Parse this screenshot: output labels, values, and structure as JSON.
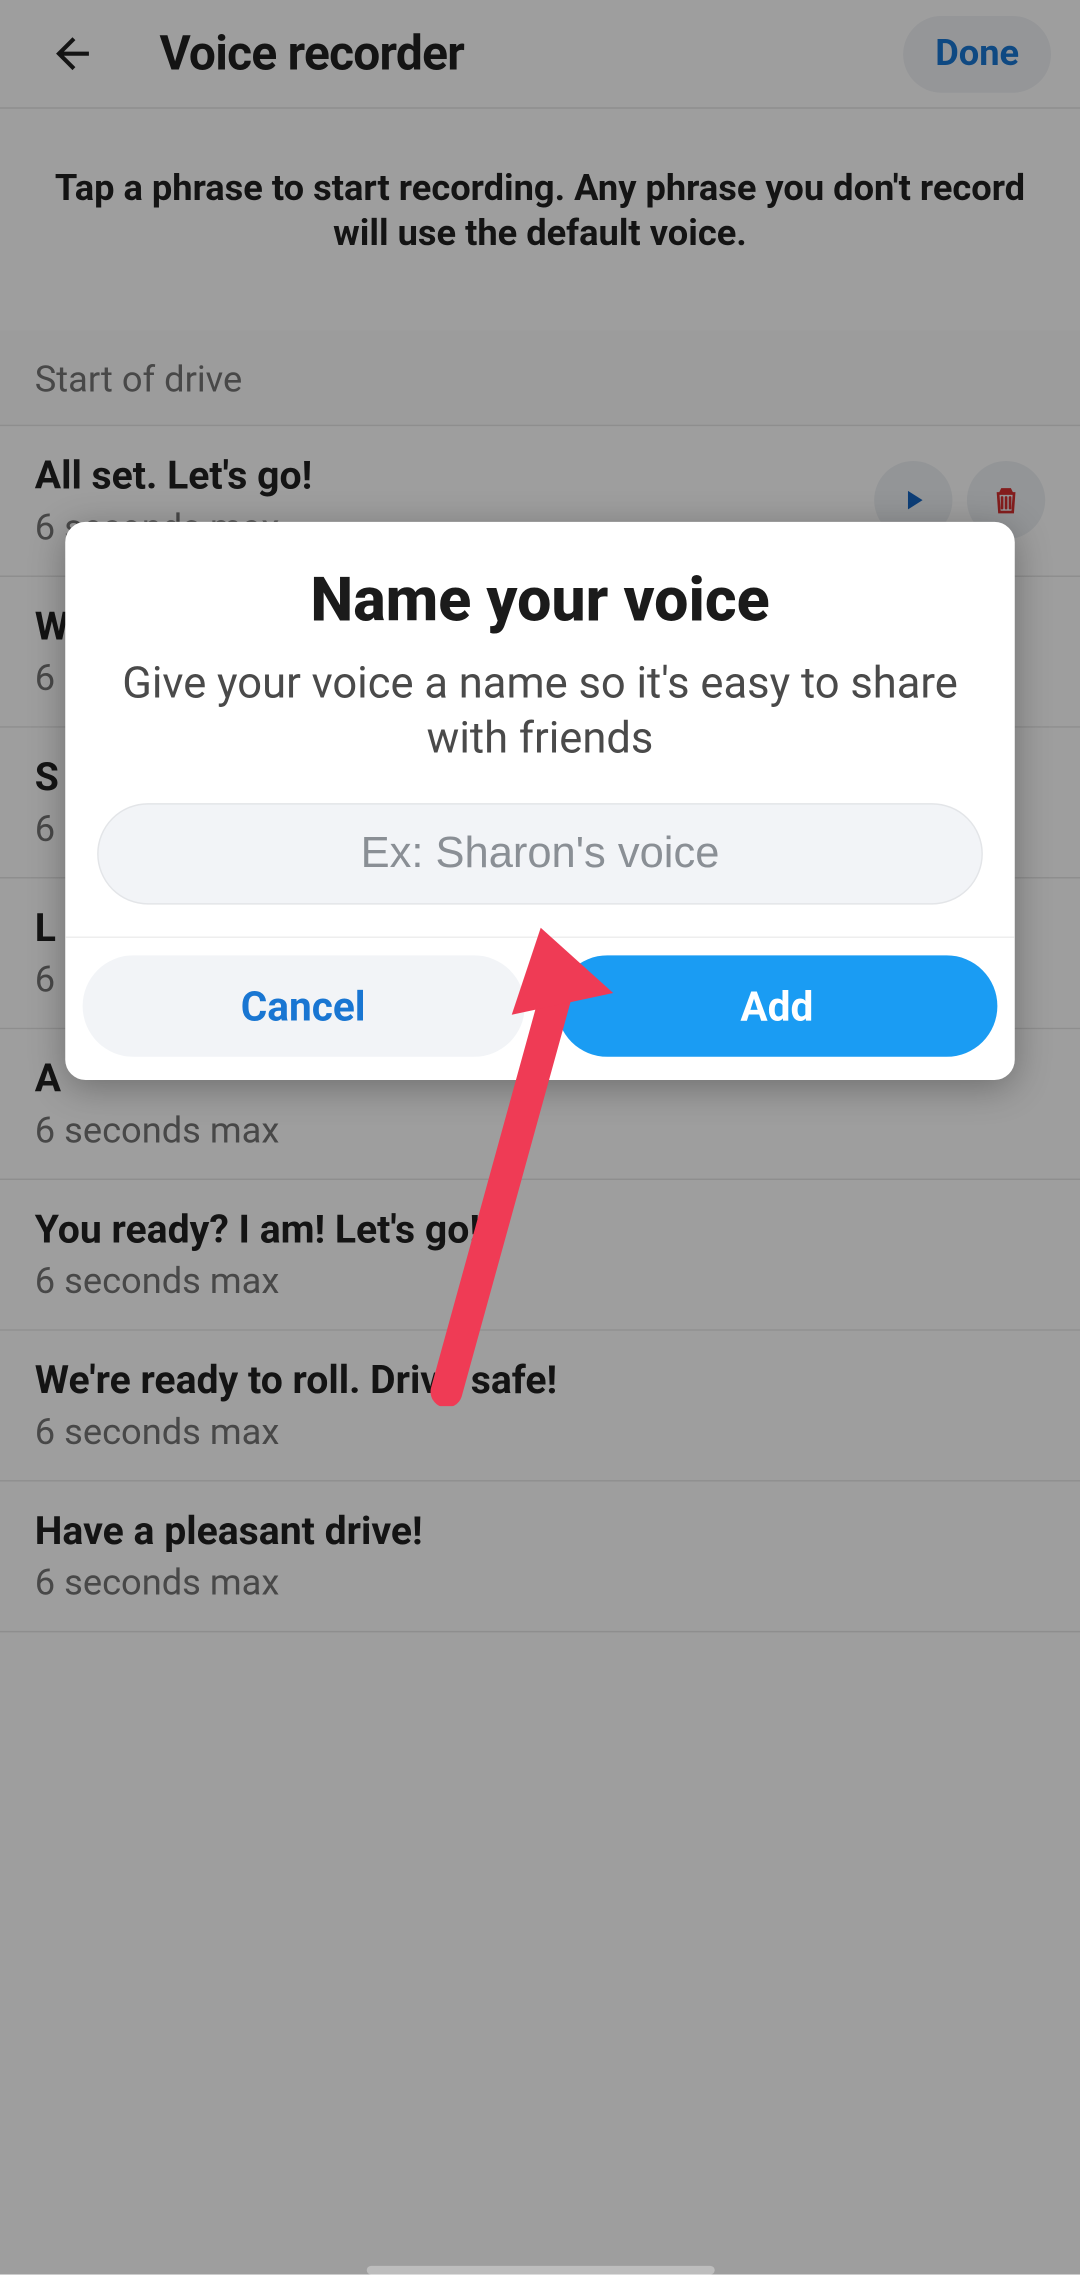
{
  "header": {
    "title": "Voice recorder",
    "done": "Done"
  },
  "instruction": "Tap a phrase to start recording. Any phrase you don't record will use the default voice.",
  "section": "Start of drive",
  "phrases": [
    {
      "title": "All set. Let's go!",
      "sub": "6 seconds max",
      "hasActions": true
    },
    {
      "title": "W",
      "sub": "6"
    },
    {
      "title": "S",
      "sub": "6"
    },
    {
      "title": "L",
      "sub": "6"
    },
    {
      "title": "A",
      "sub": "6 seconds max"
    },
    {
      "title": "You ready? I am! Let's go!",
      "sub": "6 seconds max"
    },
    {
      "title": "We're ready to roll. Drive safe!",
      "sub": "6 seconds max"
    },
    {
      "title": "Have a pleasant drive!",
      "sub": "6 seconds max"
    }
  ],
  "modal": {
    "title": "Name your voice",
    "sub": "Give your voice a name so it's easy to share with friends",
    "placeholder": "Ex: Sharon's voice",
    "cancel": "Cancel",
    "add": "Add"
  },
  "colors": {
    "accent": "#1a9cf3",
    "link": "#1976d2",
    "danger": "#d32f2f"
  }
}
